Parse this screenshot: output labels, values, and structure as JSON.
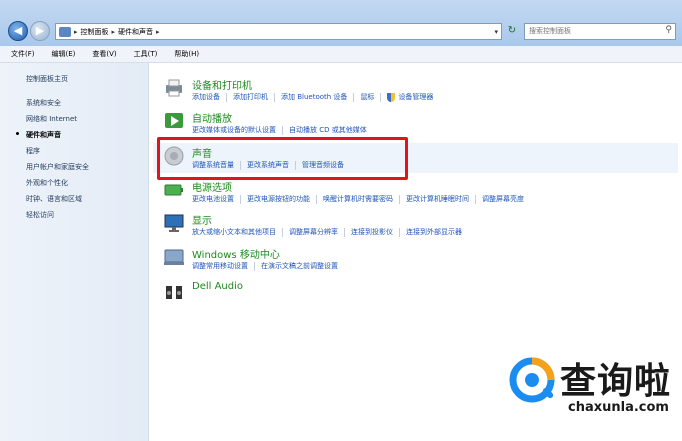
{
  "address": {
    "crumbs": [
      "控制面板",
      "硬件和声音"
    ],
    "search_placeholder": "搜索控制面板"
  },
  "menubar": {
    "items": [
      "文件(F)",
      "编辑(E)",
      "查看(V)",
      "工具(T)",
      "帮助(H)"
    ]
  },
  "sidebar": {
    "home": "控制面板主页",
    "items": [
      "系统和安全",
      "网络和 Internet",
      "硬件和声音",
      "程序",
      "用户帐户和家庭安全",
      "外观和个性化",
      "时钟、语言和区域",
      "轻松访问"
    ],
    "current_index": 2
  },
  "categories": [
    {
      "title": "设备和打印机",
      "icon": "printer-icon",
      "links": [
        "添加设备",
        "添加打印机",
        "添加 Bluetooth 设备",
        "鼠标",
        "设备管理器"
      ]
    },
    {
      "title": "自动播放",
      "icon": "autoplay-icon",
      "links": [
        "更改媒体或设备的默认设置",
        "自动播放 CD 或其他媒体"
      ]
    },
    {
      "title": "声音",
      "icon": "speaker-icon",
      "links": [
        "调整系统音量",
        "更改系统声音",
        "管理音频设备"
      ]
    },
    {
      "title": "电源选项",
      "icon": "battery-icon",
      "links": [
        "更改电池设置",
        "更改电源按钮的功能",
        "唤醒计算机时需要密码",
        "更改计算机睡眠时间",
        "调整屏幕亮度"
      ]
    },
    {
      "title": "显示",
      "icon": "display-icon",
      "links": [
        "放大或缩小文本和其他项目",
        "调整屏幕分辨率",
        "连接到投影仪",
        "连接到外部显示器"
      ]
    },
    {
      "title": "Windows 移动中心",
      "icon": "mobility-center-icon",
      "links": [
        "调整常用移动设置",
        "在演示文稿之前调整设置"
      ]
    },
    {
      "title": "Dell Audio",
      "icon": "dell-audio-icon",
      "links": []
    }
  ],
  "watermark": {
    "name": "查询啦",
    "url": "chaxunla.com"
  },
  "colors": {
    "category_title": "#1e8a1e",
    "link": "#1f55b8",
    "highlight_box": "#e2131b"
  }
}
